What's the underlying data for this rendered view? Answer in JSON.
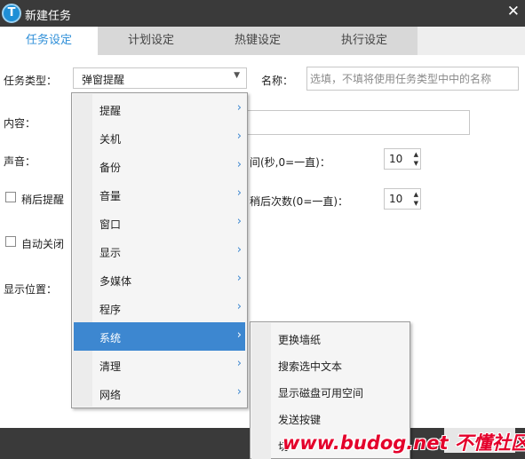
{
  "window": {
    "title": "新建任务",
    "app_icon_glyph": "T",
    "close_glyph": "✕"
  },
  "tabs": [
    {
      "label": "任务设定",
      "active": true
    },
    {
      "label": "计划设定",
      "active": false
    },
    {
      "label": "热键设定",
      "active": false
    },
    {
      "label": "执行设定",
      "active": false
    }
  ],
  "form": {
    "task_type_label": "任务类型：",
    "task_type_value": "弹窗提醒",
    "name_label": "名称：",
    "name_placeholder": "选填，不填将使用任务类型中中的名称",
    "content_label": "内容：",
    "sound_label": "声音：",
    "interval_label": "间(秒,0=一直)：",
    "interval_value": "10",
    "snooze_label": "稍后提醒",
    "snooze_count_label": "稍后次数(0=一直)：",
    "snooze_count_value": "10",
    "auto_close_label": "自动关闭",
    "display_position_label": "显示位置："
  },
  "menu": {
    "items": [
      {
        "label": "提醒",
        "icon": "chevron-right-icon"
      },
      {
        "label": "关机",
        "icon": "chevron-right-icon"
      },
      {
        "label": "备份",
        "icon": "chevron-right-icon"
      },
      {
        "label": "音量",
        "icon": "chevron-right-icon"
      },
      {
        "label": "窗口",
        "icon": "chevron-right-icon"
      },
      {
        "label": "显示",
        "icon": "chevron-right-icon"
      },
      {
        "label": "多媒体",
        "icon": "chevron-right-icon"
      },
      {
        "label": "程序",
        "icon": "chevron-right-icon"
      },
      {
        "label": "系统",
        "icon": "chevron-right-icon",
        "selected": true
      },
      {
        "label": "清理",
        "icon": "chevron-right-icon"
      },
      {
        "label": "网络",
        "icon": "chevron-right-icon"
      }
    ],
    "arrow_glyph": "›"
  },
  "submenu": {
    "items": [
      {
        "label": "更换墙纸"
      },
      {
        "label": "搜索选中文本"
      },
      {
        "label": "显示磁盘可用空间"
      },
      {
        "label": "发送按键"
      },
      {
        "label": "切"
      }
    ]
  },
  "watermark": {
    "text": "www.budog.net 不懂社区"
  },
  "colors": {
    "accent": "#2f8fd8",
    "menu_selected": "#3d87d0",
    "titlebar": "#3a3a3a",
    "watermark": "#e4002b"
  }
}
